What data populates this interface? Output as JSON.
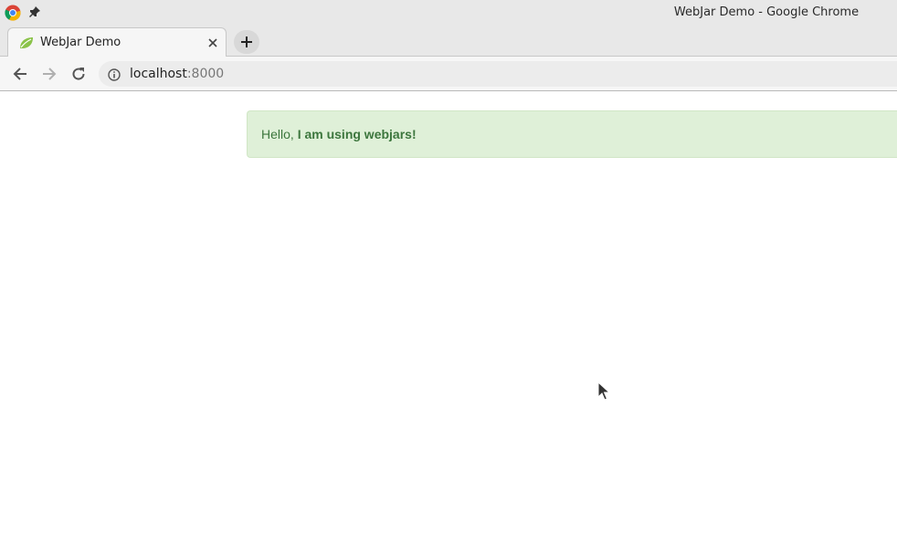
{
  "window": {
    "title": "WebJar Demo - Google Chrome"
  },
  "tabs": [
    {
      "title": "WebJar Demo",
      "favicon": "spring-leaf-icon",
      "active": true
    }
  ],
  "toolbar": {
    "url_host": "localhost",
    "url_port": ":8000"
  },
  "page": {
    "alert": {
      "prefix": "Hello, ",
      "emphasis": "I am using webjars!"
    }
  },
  "colors": {
    "alert_background": "#dff0d8",
    "alert_text": "#3c763d",
    "favicon_green": "#8bc34a"
  }
}
